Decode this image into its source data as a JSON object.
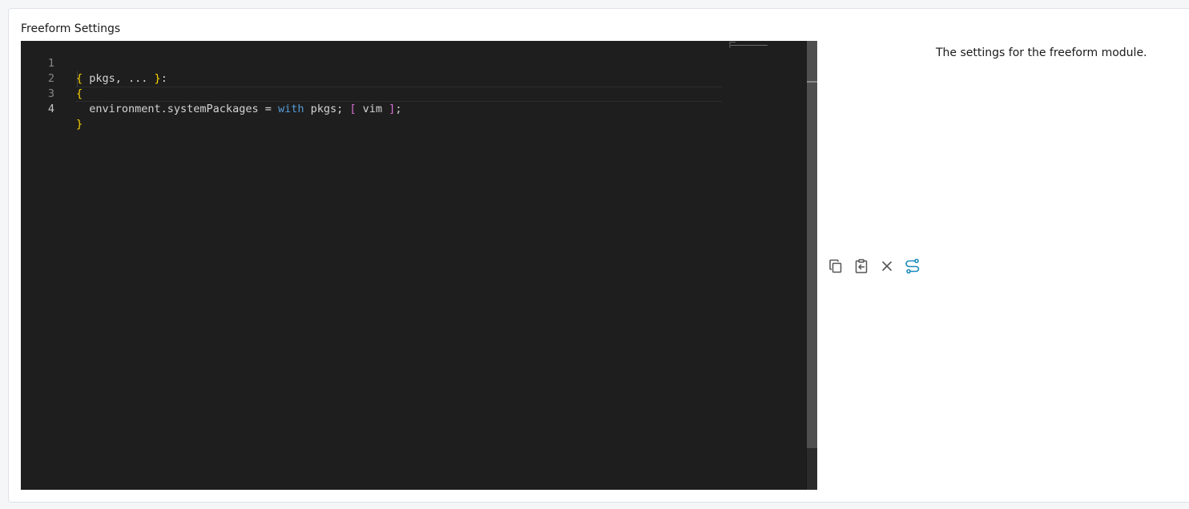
{
  "field": {
    "label": "Freeform Settings",
    "description": "The settings for the freeform module."
  },
  "editor": {
    "lines": [
      {
        "number": "1",
        "tokens": [
          {
            "text": "{",
            "kind": "brace-y"
          },
          {
            "text": " pkgs, ... ",
            "kind": "plain"
          },
          {
            "text": "}",
            "kind": "brace-y"
          },
          {
            "text": ":",
            "kind": "plain"
          }
        ]
      },
      {
        "number": "2",
        "tokens": [
          {
            "text": "{",
            "kind": "brace-y"
          }
        ]
      },
      {
        "number": "3",
        "tokens": [
          {
            "text": "  environment.systemPackages = ",
            "kind": "plain"
          },
          {
            "text": "with",
            "kind": "kw"
          },
          {
            "text": " pkgs; ",
            "kind": "plain"
          },
          {
            "text": "[",
            "kind": "brace-p"
          },
          {
            "text": " vim ",
            "kind": "plain"
          },
          {
            "text": "]",
            "kind": "brace-p"
          },
          {
            "text": ";",
            "kind": "plain"
          }
        ]
      },
      {
        "number": "4",
        "tokens": [
          {
            "text": "}",
            "kind": "brace-y"
          }
        ]
      }
    ],
    "active_line": "4",
    "colors": {
      "background": "#1e1e1e",
      "brace_yellow": "#ffd700",
      "brace_pink": "#da70d6",
      "keyword": "#569cd6",
      "text": "#d4d4d4"
    }
  },
  "toolbar": {
    "buttons": [
      {
        "icon": "copy-icon",
        "action": "copy"
      },
      {
        "icon": "paste-icon",
        "action": "paste"
      },
      {
        "icon": "close-icon",
        "action": "clear"
      },
      {
        "icon": "route-settings-icon",
        "action": "toggle",
        "active": true
      }
    ],
    "accent": "#1a8bbd"
  }
}
